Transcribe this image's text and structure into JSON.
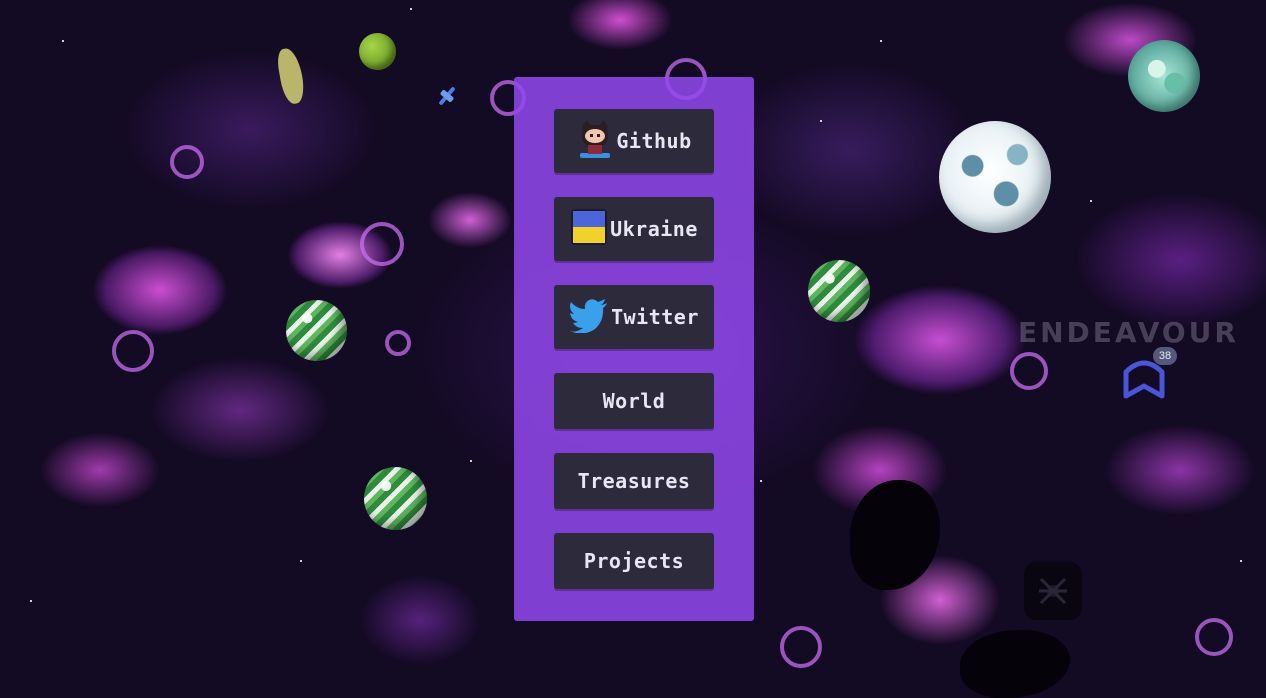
{
  "menu": {
    "github": {
      "label": "Github",
      "icon": "octocat-icon"
    },
    "ukraine": {
      "label": "Ukraine",
      "icon": "ukraine-flag-icon"
    },
    "twitter": {
      "label": "Twitter",
      "icon": "twitter-bird-icon"
    },
    "world": {
      "label": "World"
    },
    "treasures": {
      "label": "Treasures"
    },
    "projects": {
      "label": "Projects"
    }
  },
  "background": {
    "watermark_text": "ENDEAVOUR",
    "chat_badge_count": "38"
  },
  "colors": {
    "panel": "#9248ec",
    "button": "#2d2a3c",
    "button_text": "#e8e6f2",
    "space": "#130a24",
    "nebula": "#e05ae8",
    "badge_icon": "#4a56d8"
  }
}
